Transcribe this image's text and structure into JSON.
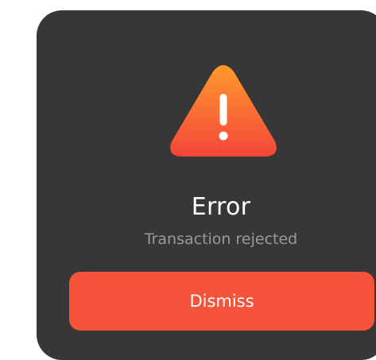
{
  "dialog": {
    "icon": "warning-triangle-icon",
    "title": "Error",
    "message": "Transaction rejected",
    "dismiss_label": "Dismiss"
  },
  "colors": {
    "dialog_background": "#373737",
    "accent": "#f5533a",
    "icon_gradient_top": "#ff9a2b",
    "icon_gradient_bottom": "#f5453a",
    "title_text": "#ffffff",
    "message_text": "#9a9a9a"
  }
}
